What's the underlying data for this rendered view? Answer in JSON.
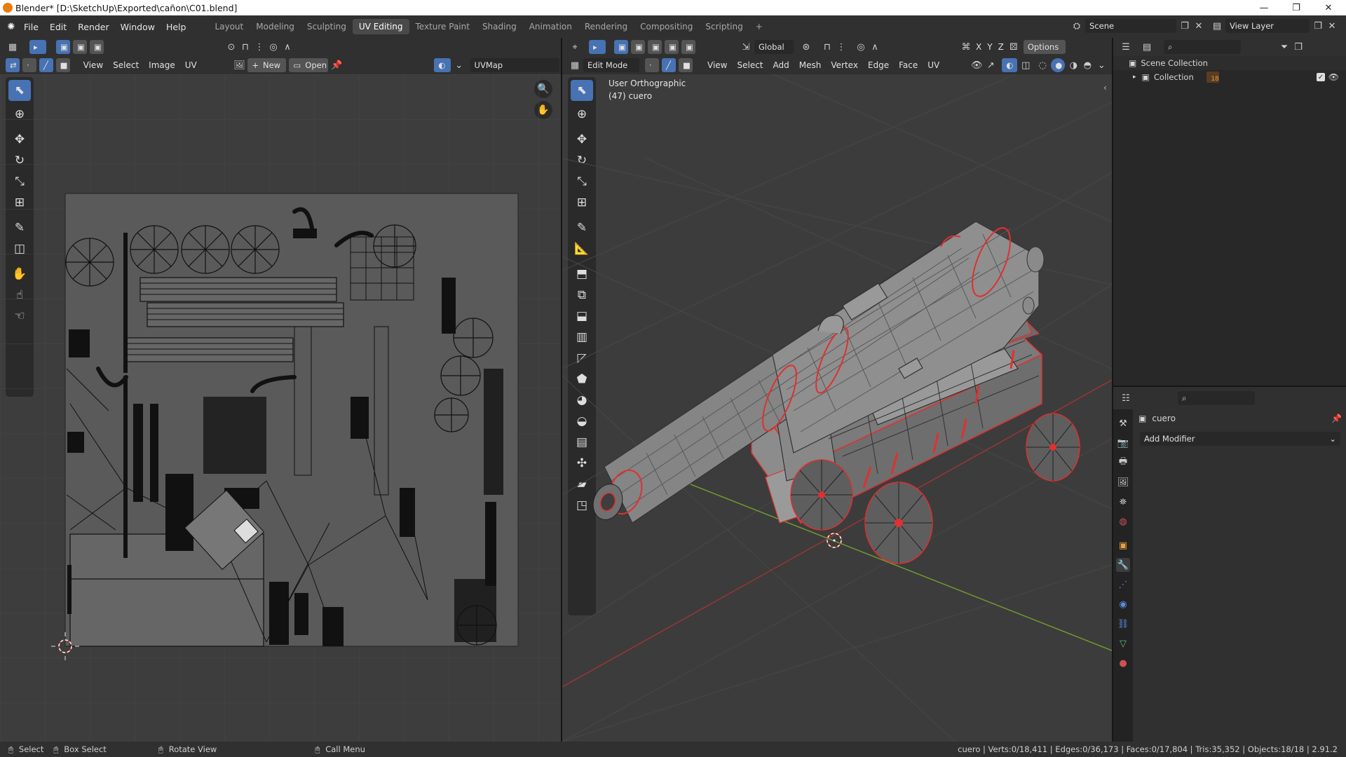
{
  "window": {
    "title": "Blender* [D:\\SketchUp\\Exported\\cañon\\C01.blend]"
  },
  "menus": [
    "File",
    "Edit",
    "Render",
    "Window",
    "Help"
  ],
  "workspaces": [
    "Layout",
    "Modeling",
    "Sculpting",
    "UV Editing",
    "Texture Paint",
    "Shading",
    "Animation",
    "Rendering",
    "Compositing",
    "Scripting"
  ],
  "active_workspace": "UV Editing",
  "scene": {
    "name": "Scene",
    "view_layer": "View Layer"
  },
  "uv_editor": {
    "menus": [
      "View",
      "Select",
      "Image",
      "UV"
    ],
    "new_label": "New",
    "open_label": "Open",
    "uvmap": "UVMap"
  },
  "viewport": {
    "mode": "Edit Mode",
    "transform": "Global",
    "options_label": "Options",
    "menus": [
      "View",
      "Select",
      "Add",
      "Mesh",
      "Vertex",
      "Edge",
      "Face",
      "UV"
    ],
    "view_name": "User Orthographic",
    "object_label": "(47) cuero",
    "axes": [
      "X",
      "Y",
      "Z"
    ]
  },
  "outliner": {
    "scene_collection": "Scene Collection",
    "collection": "Collection",
    "badge": "18"
  },
  "properties": {
    "object": "cuero",
    "add_modifier": "Add Modifier"
  },
  "status": {
    "select": "Select",
    "box_select": "Box Select",
    "rotate_view": "Rotate View",
    "call_menu": "Call Menu",
    "stats": "cuero | Verts:0/18,411 | Edges:0/36,173 | Faces:0/17,804 | Tris:35,352 | Objects:18/18 | 2.91.2"
  },
  "colors": {
    "accent": "#4772b3",
    "selection": "#e03030",
    "x_axis": "#9b3535",
    "y_axis": "#6e9a2e"
  }
}
